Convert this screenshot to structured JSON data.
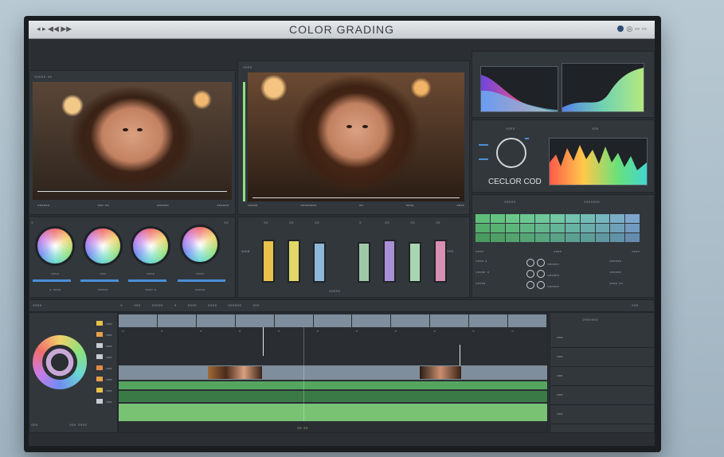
{
  "app": {
    "title": "COLOR GRADING",
    "left_caption": "◂ ▸ ◀◀ ▶▶",
    "right_caption": "◎ ◦◦ ◦◦"
  },
  "viewers": {
    "source_label": "◦◦◦◦◦  ◦◦",
    "program_label": "◦◦◦◦",
    "source_footer": [
      "◦◦◦◦◦◦",
      "◦◦◦ ◦◦",
      "◦◦◦◦◦◦",
      "◦◦◦◦◦◦"
    ],
    "program_footer": [
      "◦◦◦◦◦",
      "◦◦◦◦◦◦◦◦",
      "◦◦",
      "◦◦◦◦",
      "◦◦◦◦"
    ]
  },
  "wheels": {
    "labels": [
      "◦◦◦◦",
      "◦◦◦",
      "◦◦◦◦",
      "◦◦◦◦"
    ],
    "values": [
      "◦ ◦◦◦◦",
      "◦◦◦◦◦",
      "◦◦◦◦ ◦",
      "◦◦◦◦◦"
    ],
    "side_tag": "◦◦",
    "left_marker": "◦"
  },
  "channels": {
    "side_left": "◦◦◦",
    "side_right": "◦◦◦",
    "top_labels": [
      "◦◦",
      "◦◦",
      "◦◦",
      "◦",
      "◦◦",
      "◦◦",
      "◦◦"
    ],
    "bottom_label": "◦◦◦◦◦",
    "fills": [
      0.8,
      0.8,
      0.75,
      0.75,
      0.8,
      0.75,
      0.8
    ],
    "colors": [
      "#e8c24a",
      "#e2d86a",
      "#8fb8d8",
      "#9fc9a6",
      "#a98fd4",
      "#a8d6b3",
      "#d78fb2"
    ]
  },
  "scopes": {
    "label_left": "◦◦◦◦",
    "label_right": "◦◦◦",
    "wheel_caption": "CECLOR COD"
  },
  "swatches": {
    "header": [
      "◦◦◦◦◦",
      "◦◦◦◦◦◦◦"
    ],
    "colors": [
      "#5fbf7a",
      "#63c481",
      "#6ac98a",
      "#6bc892",
      "#6ec89b",
      "#71c6a4",
      "#72c2ad",
      "#73bdb6",
      "#76b6be",
      "#7aaec6",
      "#7ea6cd",
      "#54ad6c",
      "#58b273",
      "#5db77b",
      "#60b784",
      "#63b78e",
      "#65b597",
      "#67b2a0",
      "#69aea8",
      "#6ba8b0",
      "#6ea1b8",
      "#729abf",
      "#4a9a60",
      "#4e9f66",
      "#52a36d",
      "#55a476",
      "#57a47f",
      "#59a288",
      "#5ba090",
      "#5d9d98",
      "#5f98a0",
      "#6292a7",
      "#658cae"
    ],
    "rows": [
      {
        "a": "◦◦◦◦ ◦",
        "b": "◦◦◦◦◦◦",
        "c": "◦◦◦◦◦◦"
      },
      {
        "a": "◦◦◦◦◦ ◦",
        "b": "◦◦◦◦◦◦",
        "c": "◦◦◦◦◦◦"
      },
      {
        "a": "◦◦◦◦◦",
        "b": "◦◦◦◦◦◦",
        "c": "◦◦◦◦ ◦◦"
      }
    ],
    "row_headers": [
      "◦◦◦◦",
      "◦◦◦◦",
      "◦◦◦◦"
    ]
  },
  "timeline": {
    "header_left": "◦◦◦◦",
    "header_items": [
      "◦",
      "◦◦◦",
      "◦◦◦◦◦",
      "◦",
      "◦◦◦◦",
      "◦◦◦◦",
      "◦◦◦◦◦◦",
      "◦◦◦"
    ],
    "header_right": "◦◦◦",
    "timecode": "◦◦ ◦◦",
    "side_title": "◦◦◦◦◦◦◦",
    "side_rows": [
      "◦◦◦",
      "◦◦◦",
      "◦◦◦",
      "◦◦◦",
      "◦◦◦"
    ],
    "track_list": [
      "◦◦◦",
      "◦◦◦",
      "◦◦◦",
      "◦◦◦",
      "◦◦◦",
      "◦◦◦",
      "◦◦◦",
      "◦◦◦"
    ],
    "bottom_left": [
      "◦◦◦",
      "◦◦◦ ◦◦◦◦"
    ],
    "ruler_marks": [
      "◦",
      "◦",
      "◦",
      "◦",
      "◦",
      "◦",
      "◦",
      "◦",
      "◦",
      "◦",
      "◦"
    ]
  }
}
